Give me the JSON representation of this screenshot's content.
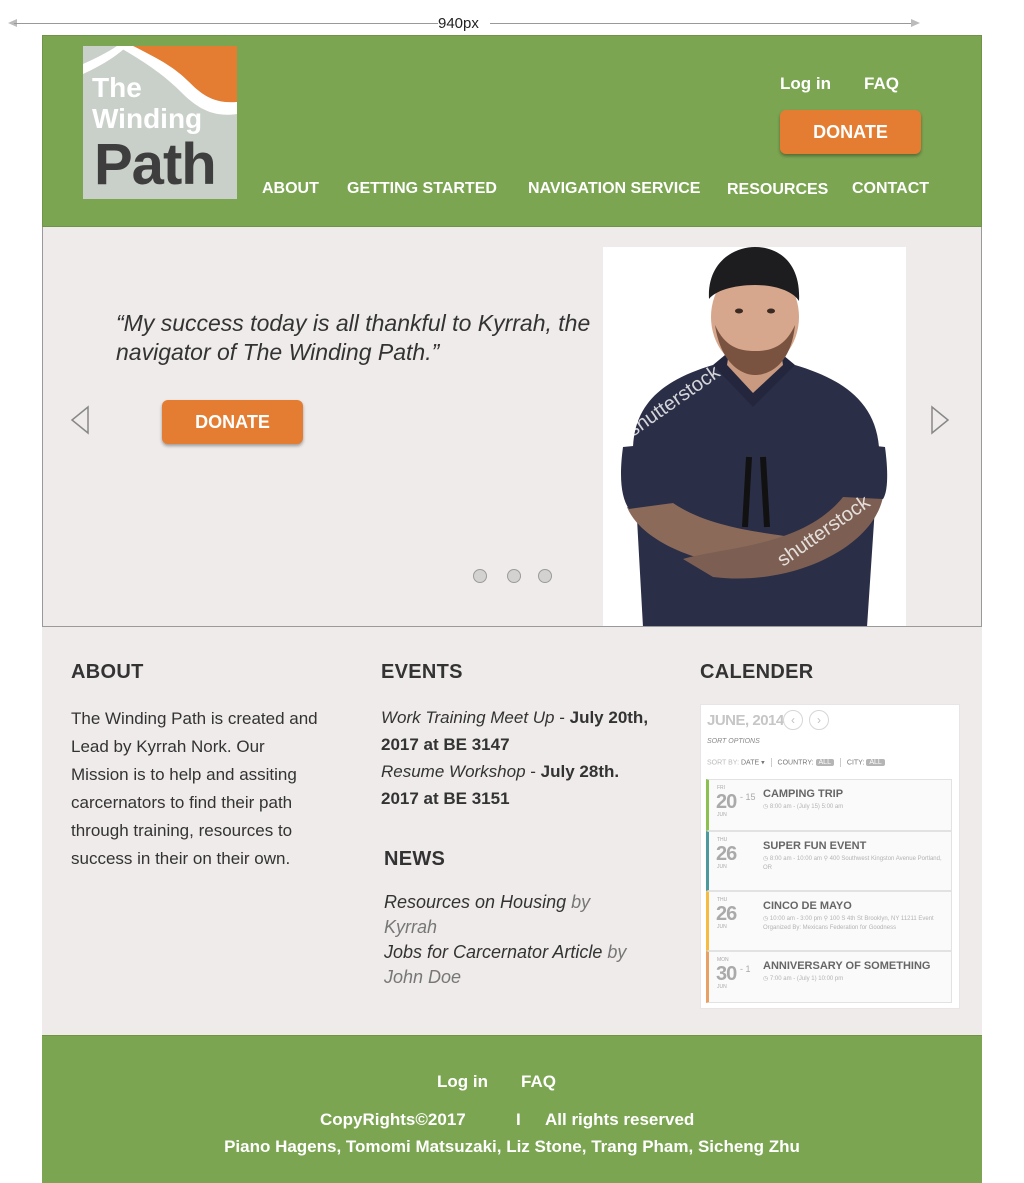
{
  "annotation": {
    "width_label": "940px"
  },
  "logo": {
    "line1": "The",
    "line2": "Winding",
    "line3": "Path"
  },
  "header": {
    "login": "Log in",
    "faq": "FAQ",
    "donate": "DONATE",
    "nav": [
      "ABOUT",
      "GETTING STARTED",
      "NAVIGATION SERVICE",
      "RESOURCES",
      "CONTACT"
    ]
  },
  "hero": {
    "quote": "“My success today is all thankful to Kyrrah, the navigator of The Winding Path.”",
    "donate": "DONATE",
    "slides_total": 3,
    "watermark": "shutterstock"
  },
  "about": {
    "title": "ABOUT",
    "text": "The Winding Path is created and Lead by Kyrrah Nork. Our Mission is to help and assiting carcernators to find their path through training, resources to success in their on their own."
  },
  "events": {
    "title": "EVENTS",
    "items": [
      {
        "name": "Work Training Meet Up",
        "sep": " - ",
        "date": "July 20th, 2017 at BE 3147"
      },
      {
        "name": "Resume Workshop",
        "sep": " - ",
        "date": "July 28th. 2017 at BE 3151"
      }
    ]
  },
  "news": {
    "title": "NEWS",
    "items": [
      {
        "title": "Resources on Housing",
        "by": " by Kyrrah"
      },
      {
        "title": "Jobs for Carcernator Article",
        "by": " by John Doe"
      }
    ]
  },
  "calendar": {
    "title": "CALENDER",
    "month": "JUNE, 2014",
    "sort_options": "SORT OPTIONS",
    "filters": {
      "sort_by": "SORT BY:",
      "date": "DATE",
      "country": "COUNTRY:",
      "country_val": "ALL",
      "city": "CITY:",
      "city_val": "ALL"
    },
    "events": [
      {
        "dow": "FRI",
        "day": "20",
        "mon": "JUN",
        "range": "- 15",
        "name": "CAMPING TRIP",
        "meta": "◷ 8:00 am - (July 15) 5:00 am",
        "color": "#8cc152"
      },
      {
        "dow": "THU",
        "day": "26",
        "mon": "JUN",
        "range": "",
        "name": "SUPER FUN EVENT",
        "meta": "◷ 8:00 am - 10:00 am  ⚲ 400 Southwest Kingston Avenue Portland, OR",
        "color": "#4a9a9e"
      },
      {
        "dow": "THU",
        "day": "26",
        "mon": "JUN",
        "range": "",
        "name": "CINCO DE MAYO",
        "meta": "◷ 10:00 am - 3:00 pm  ⚲ 100 S 4th St Brooklyn, NY 11211  Event Organized By: Mexicans Federation for Goodness",
        "color": "#f6bb42"
      },
      {
        "dow": "MON",
        "day": "30",
        "mon": "JUN",
        "range": "- 1",
        "name": "ANNIVERSARY OF SOMETHING",
        "meta": "◷ 7:00 am - (July 1) 10:00 pm",
        "color": "#e9a066"
      }
    ]
  },
  "footer": {
    "login": "Log in",
    "faq": "FAQ",
    "copyright": "CopyRights©2017",
    "bar": "I",
    "rights": "All rights reserved",
    "authors": "Piano Hagens, Tomomi Matsuzaki, Liz Stone, Trang Pham, Sicheng Zhu"
  },
  "colors": {
    "green": "#7ca552",
    "orange": "#e47d32",
    "panel": "#efebea"
  }
}
